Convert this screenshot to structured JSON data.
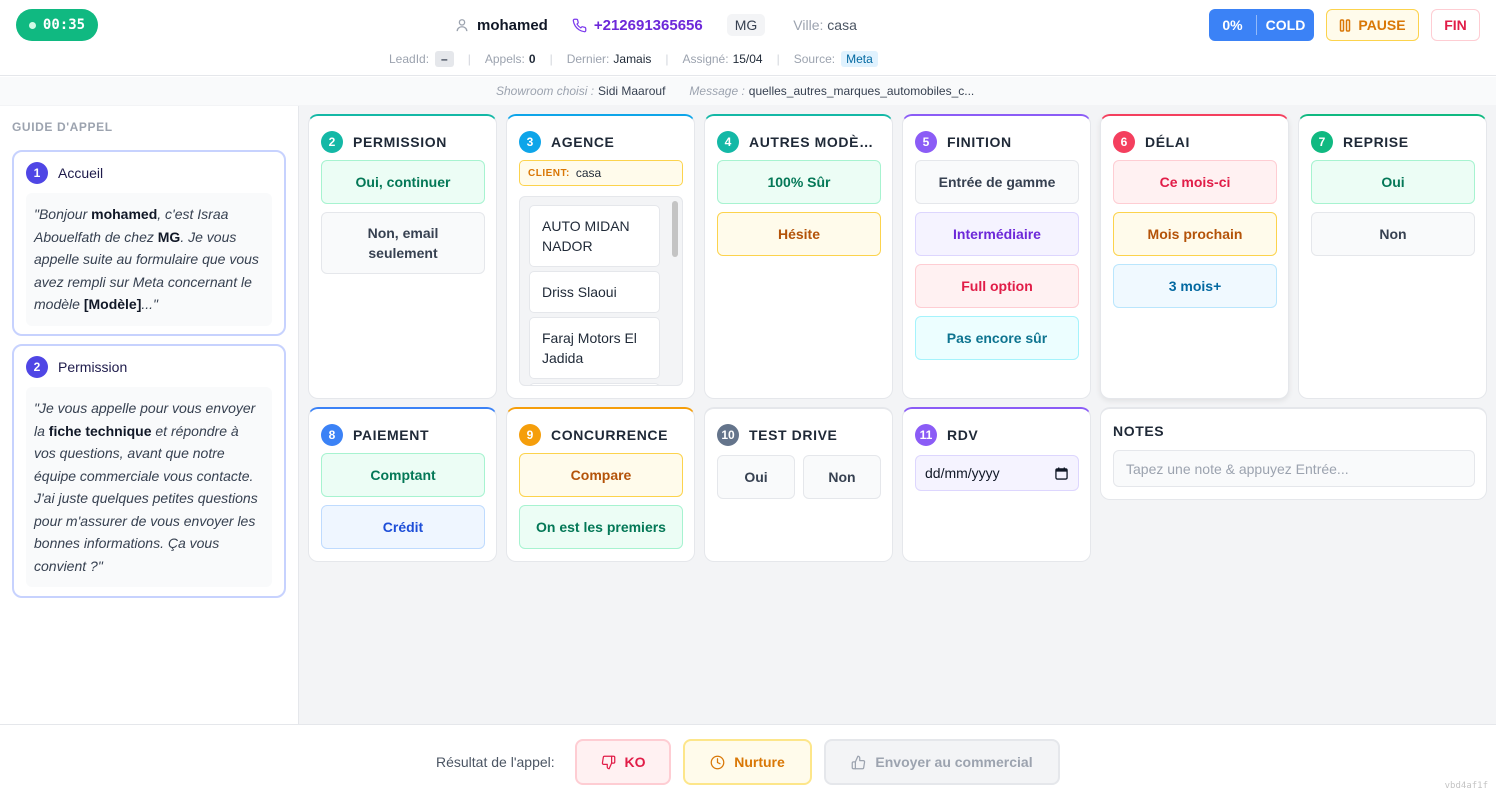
{
  "header": {
    "timer": "00:35",
    "user_name": "mohamed",
    "phone": "+212691365656",
    "brand": "MG",
    "ville_label": "Ville:",
    "ville_value": "casa",
    "score_percent": "0%",
    "score_label": "COLD",
    "pause_label": "PAUSE",
    "fin_label": "FIN",
    "meta": {
      "leadid_label": "LeadId:",
      "leadid_value": "–",
      "appels_label": "Appels:",
      "appels_value": "0",
      "dernier_label": "Dernier:",
      "dernier_value": "Jamais",
      "assigne_label": "Assigné:",
      "assigne_value": "15/04",
      "source_label": "Source:",
      "source_value": "Meta"
    }
  },
  "subbar": {
    "showroom_label": "Showroom choisi :",
    "showroom_value": "Sidi Maarouf",
    "message_label": "Message :",
    "message_value": "quelles_autres_marques_automobiles_c..."
  },
  "guide": {
    "title": "GUIDE D'APPEL",
    "steps": [
      {
        "num": "1",
        "title": "Accueil"
      },
      {
        "num": "2",
        "title": "Permission"
      }
    ],
    "step1_text": {
      "p1": "\"Bonjour ",
      "name": "mohamed",
      "p2": ", c'est Israa Abouelfath de chez ",
      "brand": "MG",
      "p3": ". Je vous appelle suite au formulaire que vous avez rempli sur Meta concernant le modèle ",
      "model": "[Modèle]",
      "p4": "...\""
    },
    "step2_text": {
      "p1": "\"Je vous appelle pour vous envoyer la ",
      "bold": "fiche technique",
      "p2": " et répondre à vos questions, avant que notre équipe commerciale vous contacte. J'ai juste quelques petites questions pour m'assurer de vous envoyer les bonnes informations. Ça vous convient ?\""
    }
  },
  "cards": {
    "permission": {
      "num": "2",
      "title": "PERMISSION",
      "options": [
        "Oui, continuer",
        "Non, email seulement"
      ]
    },
    "agence": {
      "num": "3",
      "title": "AGENCE",
      "client_key": "CLIENT:",
      "client_value": "casa",
      "items": [
        "AUTO MIDAN NADOR",
        "Driss Slaoui",
        "Faraj Motors El Jadida"
      ]
    },
    "autres": {
      "num": "4",
      "title": "AUTRES MODÈL...",
      "options": [
        "100% Sûr",
        "Hésite"
      ]
    },
    "finition": {
      "num": "5",
      "title": "FINITION",
      "options": [
        "Entrée de gamme",
        "Intermédiaire",
        "Full option",
        "Pas encore sûr"
      ]
    },
    "delai": {
      "num": "6",
      "title": "DÉLAI",
      "options": [
        "Ce mois-ci",
        "Mois prochain",
        "3 mois+"
      ]
    },
    "reprise": {
      "num": "7",
      "title": "REPRISE",
      "options": [
        "Oui",
        "Non"
      ]
    },
    "paiement": {
      "num": "8",
      "title": "PAIEMENT",
      "options": [
        "Comptant",
        "Crédit"
      ]
    },
    "concurrence": {
      "num": "9",
      "title": "CONCURRENCE",
      "options": [
        "Compare",
        "On est les premiers"
      ]
    },
    "testdrive": {
      "num": "10",
      "title": "TEST DRIVE",
      "options": [
        "Oui",
        "Non"
      ]
    },
    "rdv": {
      "num": "11",
      "title": "RDV",
      "date_placeholder": "dd/mm/yyyy"
    },
    "notes": {
      "title": "NOTES",
      "placeholder": "Tapez une note & appuyez Entrée..."
    }
  },
  "footer": {
    "label": "Résultat de l'appel:",
    "ko": "KO",
    "nurture": "Nurture",
    "send": "Envoyer au commercial",
    "version": "vbd4af1f"
  },
  "colors": {
    "green": "#10b981",
    "teal": "#14b8a6",
    "sky": "#0ea5e9",
    "purple": "#8b5cf6",
    "rose": "#f43f5e",
    "blue": "#3b82f6",
    "amber": "#f59e0b",
    "slate": "#64748b",
    "indigo": "#4f46e5"
  }
}
